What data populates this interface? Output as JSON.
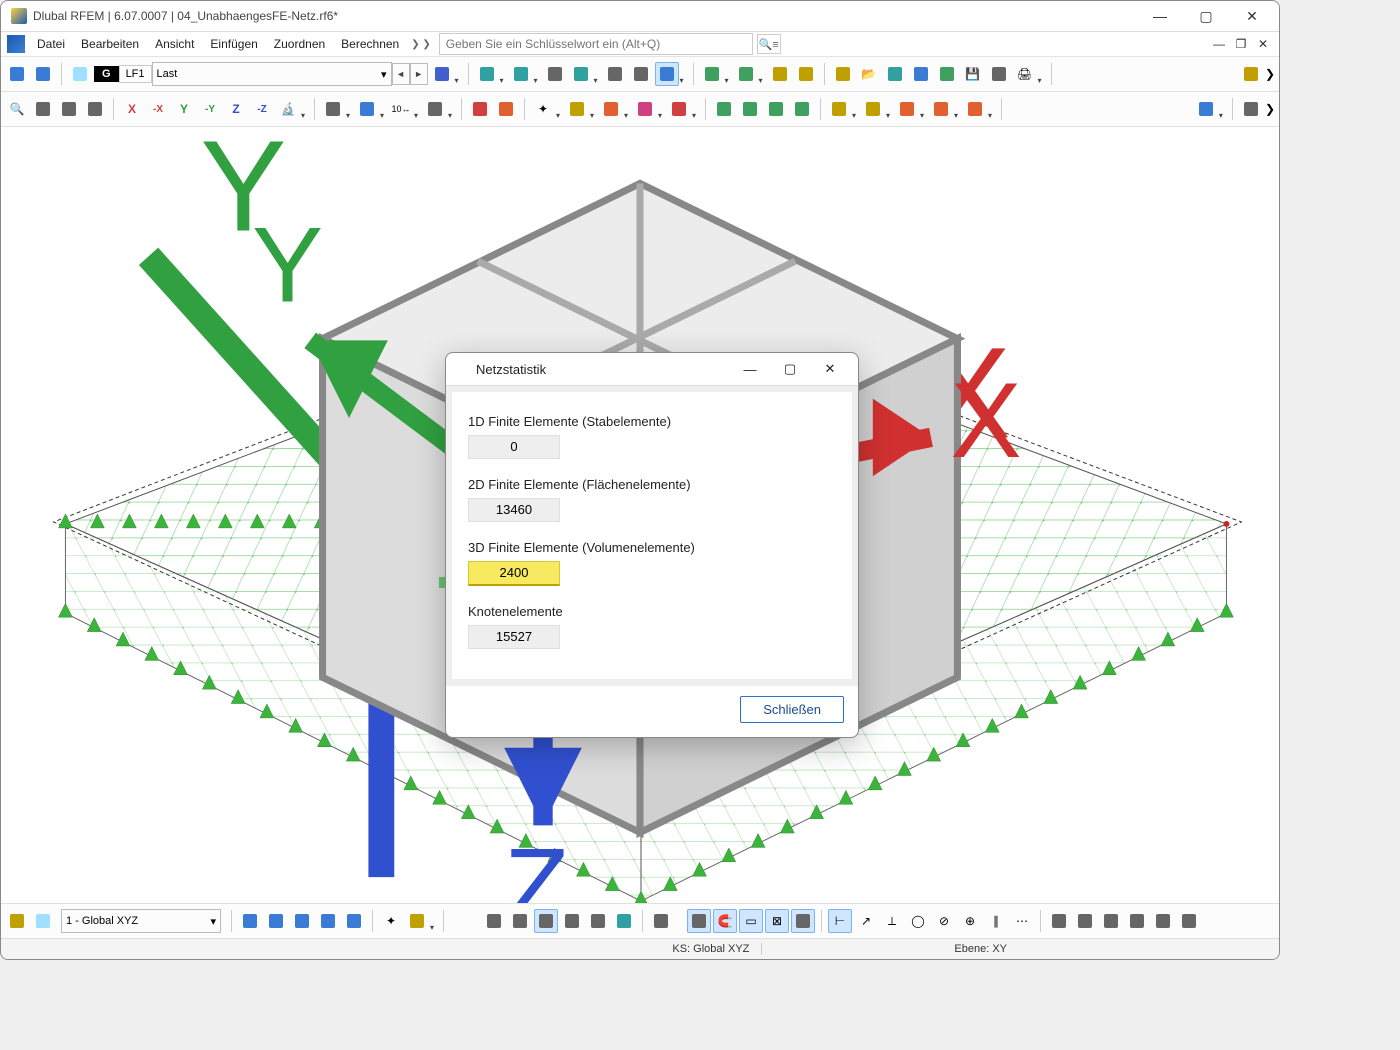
{
  "app": {
    "title": "Dlubal RFEM | 6.07.0007 | 04_UnabhaengesFE-Netz.rf6*"
  },
  "menu": {
    "items": [
      "Datei",
      "Bearbeiten",
      "Ansicht",
      "Einfügen",
      "Zuordnen",
      "Berechnen"
    ],
    "search_placeholder": "Geben Sie ein Schlüsselwort ein (Alt+Q)"
  },
  "loadcase": {
    "g": "G",
    "lf": "LF1",
    "name": "Last"
  },
  "dialog": {
    "title": "Netzstatistik",
    "f1_label": "1D Finite Elemente (Stabelemente)",
    "f1_value": "0",
    "f2_label": "2D Finite Elemente (Flächenelemente)",
    "f2_value": "13460",
    "f3_label": "3D Finite Elemente (Volumenelemente)",
    "f3_value": "2400",
    "f4_label": "Knotenelemente",
    "f4_value": "15527",
    "close": "Schließen"
  },
  "bottombar": {
    "view": "1 - Global XYZ"
  },
  "status": {
    "ks": "KS: Global XYZ",
    "ebene": "Ebene: XY"
  },
  "navcube": {
    "x": "-X",
    "y": "-Y"
  },
  "axis": {
    "x": "X",
    "y": "Y",
    "z": "Z"
  }
}
